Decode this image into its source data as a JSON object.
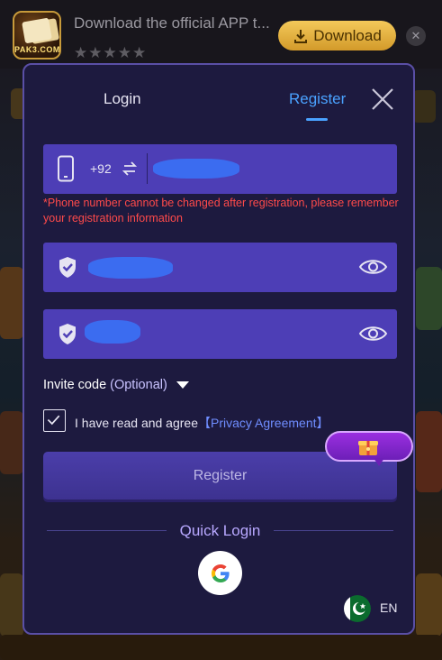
{
  "banner": {
    "app_brand": "PAK3.COM",
    "title": "Download the official APP t...",
    "stars": "★★★★★",
    "download_label": "Download",
    "close_glyph": "✕"
  },
  "modal": {
    "tabs": {
      "login": "Login",
      "register": "Register"
    },
    "active_tab": "register",
    "phone": {
      "country_code": "+92",
      "value": ""
    },
    "warning": "*Phone number cannot be changed after registration, please remember your registration information",
    "password": {
      "value": ""
    },
    "confirm_password": {
      "value": ""
    },
    "invite": {
      "label": "Invite code",
      "optional": "(Optional)"
    },
    "agreement": {
      "checked": true,
      "text": "I have read and agree",
      "link": "【Privacy Agreement】"
    },
    "register_button": "Register",
    "quick_login": "Quick Login",
    "language": "EN"
  },
  "icons": [
    "phone-icon",
    "swap-icon",
    "shield-icon",
    "eye-icon",
    "close-icon",
    "google-icon",
    "gift-icon",
    "pakistan-flag-icon",
    "download-icon",
    "caret-down-icon",
    "checkmark-icon"
  ],
  "colors": {
    "modal_bg": "#1d1a3f",
    "field_bg": "#4d3eb6",
    "accent": "#4aa2ff",
    "warning": "#ff4a4a",
    "link": "#6f8dff"
  }
}
